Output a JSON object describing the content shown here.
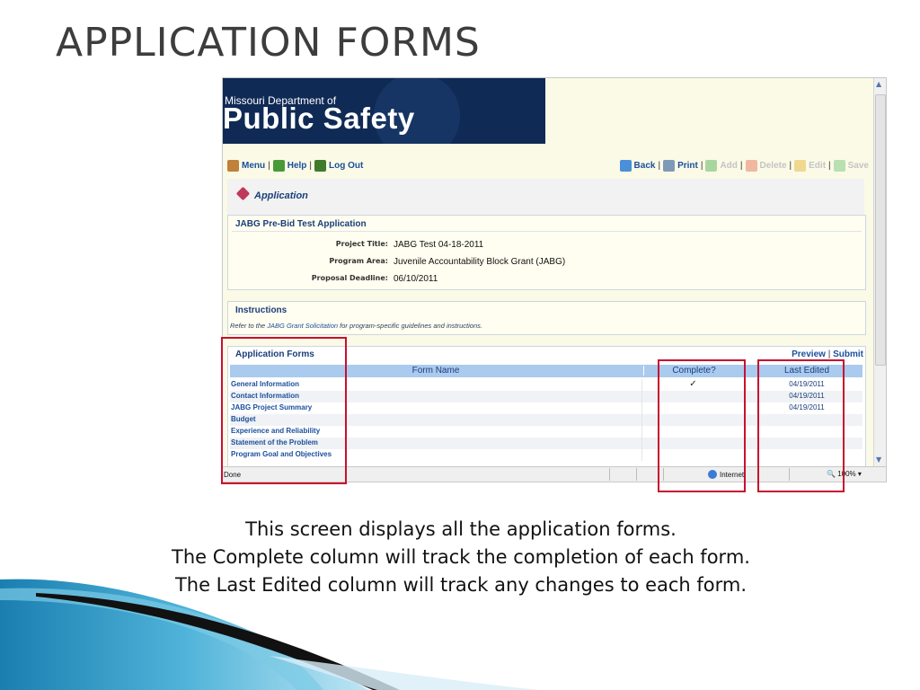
{
  "slide": {
    "title": "APPLICATION FORMS",
    "caption_lines": [
      "This screen displays all the application forms.",
      "The Complete column will track the completion of each form.",
      "The Last Edited column will track any changes to each form."
    ]
  },
  "banner": {
    "line1": "Missouri Department of",
    "line2": "Public Safety"
  },
  "toolbar": {
    "menu": "Menu",
    "help": "Help",
    "logout": "Log Out",
    "back": "Back",
    "print": "Print",
    "add": "Add",
    "delete": "Delete",
    "edit": "Edit",
    "save": "Save",
    "separator": "|"
  },
  "application_header": "Application",
  "info": {
    "heading": "JABG Pre-Bid Test Application",
    "fields": [
      {
        "label": "Project Title:",
        "value": "JABG Test 04-18-2011"
      },
      {
        "label": "Program Area:",
        "value": "Juvenile Accountability Block Grant (JABG)"
      },
      {
        "label": "Proposal Deadline:",
        "value": "06/10/2011"
      }
    ]
  },
  "instructions": {
    "heading": "Instructions",
    "prefix": "Refer to the ",
    "link": "JABG Grant Solicitation",
    "suffix": " for program-specific guidelines and instructions."
  },
  "forms": {
    "heading": "Application Forms",
    "preview": "Preview",
    "submit": "Submit",
    "columns": [
      "Form Name",
      "Complete?",
      "Last Edited"
    ],
    "rows": [
      {
        "name": "General Information",
        "complete": "✓",
        "edited": "04/19/2011"
      },
      {
        "name": "Contact Information",
        "complete": "",
        "edited": "04/19/2011"
      },
      {
        "name": "JABG Project Summary",
        "complete": "",
        "edited": "04/19/2011"
      },
      {
        "name": "Budget",
        "complete": "",
        "edited": ""
      },
      {
        "name": "Experience and Reliability",
        "complete": "",
        "edited": ""
      },
      {
        "name": "Statement of the Problem",
        "complete": "",
        "edited": ""
      },
      {
        "name": "Program Goal and Objectives",
        "complete": "",
        "edited": ""
      }
    ]
  },
  "statusbar": {
    "left": "Done",
    "zone": "Internet",
    "zoom": "100%"
  },
  "colors": {
    "highlight": "#c8102e",
    "table_header": "#aacaee",
    "link": "#1a4f9c",
    "title": "#3d3d3d"
  }
}
